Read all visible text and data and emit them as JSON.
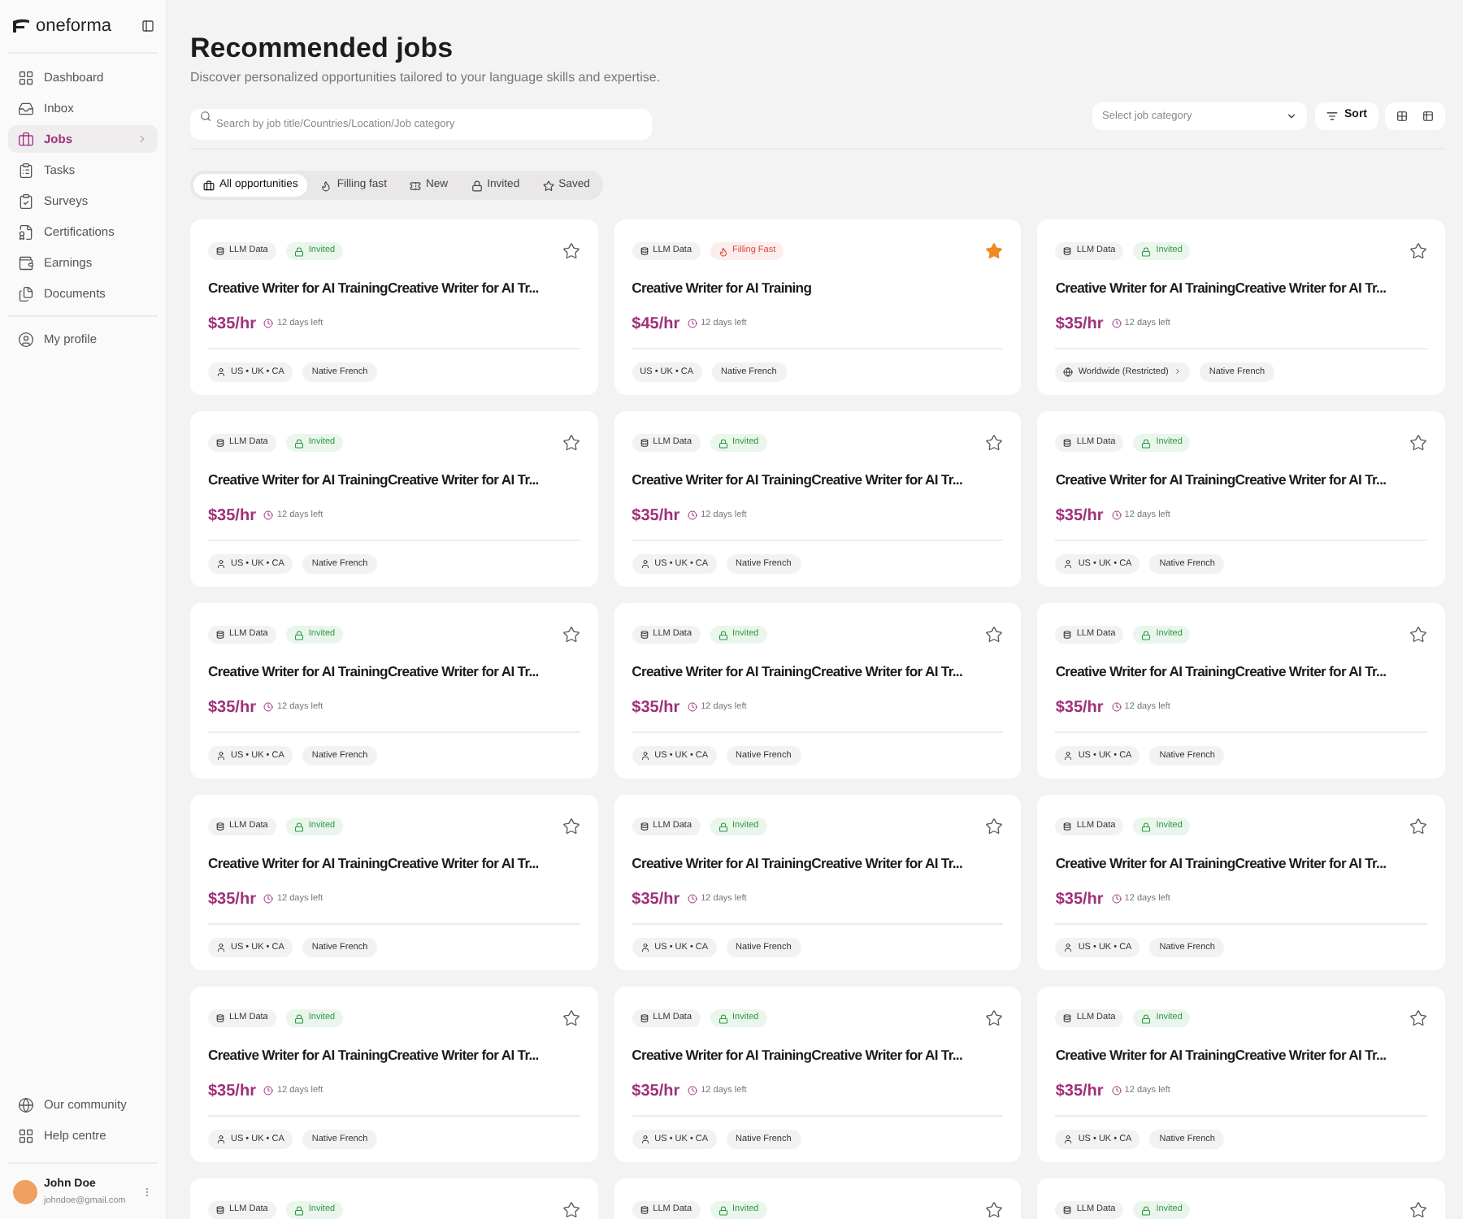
{
  "sidebar": {
    "logo": "oneforma",
    "items": [
      {
        "label": "Dashboard",
        "selected": false
      },
      {
        "label": "Inbox",
        "selected": false
      },
      {
        "label": "Jobs",
        "selected": true
      },
      {
        "label": "Tasks",
        "selected": false
      },
      {
        "label": "Surveys",
        "selected": false
      },
      {
        "label": "Certifications",
        "selected": false
      },
      {
        "label": "Earnings",
        "selected": false
      },
      {
        "label": "Documents",
        "selected": false
      }
    ],
    "profile_item": {
      "label": "My profile",
      "selected": false
    },
    "footer_items": [
      {
        "label": "Our community"
      },
      {
        "label": "Help centre"
      }
    ],
    "user": {
      "name": "John Doe",
      "email": "johndoe@gmail.com"
    }
  },
  "header": {
    "title": "Recommended jobs",
    "subtitle": "Discover personalized opportunities tailored to your language skills and expertise."
  },
  "toolbar": {
    "search": {
      "placeholder": "Search by job title/Countries/Location/Job category"
    },
    "category_select": {
      "placeholder": "Select job category"
    },
    "sort": "Sort",
    "view_toggle": [
      {
        "kind": "grid",
        "selected": false
      },
      {
        "kind": "table",
        "selected": false
      }
    ]
  },
  "filters": [
    {
      "label": "All opportunities",
      "kind": "all",
      "selected": true
    },
    {
      "label": "Filling fast",
      "kind": "fire",
      "selected": false
    },
    {
      "label": "New",
      "kind": "new",
      "selected": false
    },
    {
      "label": "Invited",
      "kind": "invited",
      "selected": false
    },
    {
      "label": "Saved",
      "kind": "saved",
      "selected": false
    }
  ],
  "jobs": [
    {
      "category": "LLM Data",
      "status": {
        "kind": "invited",
        "label": "Invited"
      },
      "saved": false,
      "title": "Creative Writer for AI TrainingCreative Writer for AI Tr...",
      "price": "$35/hr",
      "deadline": "12 days left",
      "location": {
        "kind": "person",
        "text": "US • UK • CA"
      },
      "language": "Native French"
    },
    {
      "category": "LLM Data",
      "status": {
        "kind": "filling",
        "label": "Filling Fast"
      },
      "saved": true,
      "title": "Creative Writer for AI Training",
      "price": "$45/hr",
      "deadline": "12 days left",
      "location": {
        "kind": "plain",
        "text": "US • UK • CA"
      },
      "language": "Native French"
    },
    {
      "category": "LLM Data",
      "status": {
        "kind": "invited",
        "label": "Invited"
      },
      "saved": false,
      "title": "Creative Writer for AI TrainingCreative Writer for AI Tr...",
      "price": "$35/hr",
      "deadline": "12 days left",
      "location": {
        "kind": "globe",
        "text": "Worldwide (Restricted)"
      },
      "language": "Native French"
    },
    {
      "category": "LLM Data",
      "status": {
        "kind": "invited",
        "label": "Invited"
      },
      "saved": false,
      "title": "Creative Writer for AI TrainingCreative Writer for AI Tr...",
      "price": "$35/hr",
      "deadline": "12 days left",
      "location": {
        "kind": "person",
        "text": "US • UK • CA"
      },
      "language": "Native French"
    },
    {
      "category": "LLM Data",
      "status": {
        "kind": "invited",
        "label": "Invited"
      },
      "saved": false,
      "title": "Creative Writer for AI TrainingCreative Writer for AI Tr...",
      "price": "$35/hr",
      "deadline": "12 days left",
      "location": {
        "kind": "person",
        "text": "US • UK • CA"
      },
      "language": "Native French"
    },
    {
      "category": "LLM Data",
      "status": {
        "kind": "invited",
        "label": "Invited"
      },
      "saved": false,
      "title": "Creative Writer for AI TrainingCreative Writer for AI Tr...",
      "price": "$35/hr",
      "deadline": "12 days left",
      "location": {
        "kind": "person",
        "text": "US • UK • CA"
      },
      "language": "Native French"
    },
    {
      "category": "LLM Data",
      "status": {
        "kind": "invited",
        "label": "Invited"
      },
      "saved": false,
      "title": "Creative Writer for AI TrainingCreative Writer for AI Tr...",
      "price": "$35/hr",
      "deadline": "12 days left",
      "location": {
        "kind": "person",
        "text": "US • UK • CA"
      },
      "language": "Native French"
    },
    {
      "category": "LLM Data",
      "status": {
        "kind": "invited",
        "label": "Invited"
      },
      "saved": false,
      "title": "Creative Writer for AI TrainingCreative Writer for AI Tr...",
      "price": "$35/hr",
      "deadline": "12 days left",
      "location": {
        "kind": "person",
        "text": "US • UK • CA"
      },
      "language": "Native French"
    },
    {
      "category": "LLM Data",
      "status": {
        "kind": "invited",
        "label": "Invited"
      },
      "saved": false,
      "title": "Creative Writer for AI TrainingCreative Writer for AI Tr...",
      "price": "$35/hr",
      "deadline": "12 days left",
      "location": {
        "kind": "person",
        "text": "US • UK • CA"
      },
      "language": "Native French"
    },
    {
      "category": "LLM Data",
      "status": {
        "kind": "invited",
        "label": "Invited"
      },
      "saved": false,
      "title": "Creative Writer for AI TrainingCreative Writer for AI Tr...",
      "price": "$35/hr",
      "deadline": "12 days left",
      "location": {
        "kind": "person",
        "text": "US • UK • CA"
      },
      "language": "Native French"
    },
    {
      "category": "LLM Data",
      "status": {
        "kind": "invited",
        "label": "Invited"
      },
      "saved": false,
      "title": "Creative Writer for AI TrainingCreative Writer for AI Tr...",
      "price": "$35/hr",
      "deadline": "12 days left",
      "location": {
        "kind": "person",
        "text": "US • UK • CA"
      },
      "language": "Native French"
    },
    {
      "category": "LLM Data",
      "status": {
        "kind": "invited",
        "label": "Invited"
      },
      "saved": false,
      "title": "Creative Writer for AI TrainingCreative Writer for AI Tr...",
      "price": "$35/hr",
      "deadline": "12 days left",
      "location": {
        "kind": "person",
        "text": "US • UK • CA"
      },
      "language": "Native French"
    },
    {
      "category": "LLM Data",
      "status": {
        "kind": "invited",
        "label": "Invited"
      },
      "saved": false,
      "title": "Creative Writer for AI TrainingCreative Writer for AI Tr...",
      "price": "$35/hr",
      "deadline": "12 days left",
      "location": {
        "kind": "person",
        "text": "US • UK • CA"
      },
      "language": "Native French"
    },
    {
      "category": "LLM Data",
      "status": {
        "kind": "invited",
        "label": "Invited"
      },
      "saved": false,
      "title": "Creative Writer for AI TrainingCreative Writer for AI Tr...",
      "price": "$35/hr",
      "deadline": "12 days left",
      "location": {
        "kind": "person",
        "text": "US • UK • CA"
      },
      "language": "Native French"
    },
    {
      "category": "LLM Data",
      "status": {
        "kind": "invited",
        "label": "Invited"
      },
      "saved": false,
      "title": "Creative Writer for AI TrainingCreative Writer for AI Tr...",
      "price": "$35/hr",
      "deadline": "12 days left",
      "location": {
        "kind": "person",
        "text": "US • UK • CA"
      },
      "language": "Native French"
    },
    {
      "category": "LLM Data",
      "status": {
        "kind": "invited",
        "label": "Invited"
      },
      "saved": false
    },
    {
      "category": "LLM Data",
      "status": {
        "kind": "invited",
        "label": "Invited"
      },
      "saved": false
    },
    {
      "category": "LLM Data",
      "status": {
        "kind": "invited",
        "label": "Invited"
      },
      "saved": false
    }
  ]
}
